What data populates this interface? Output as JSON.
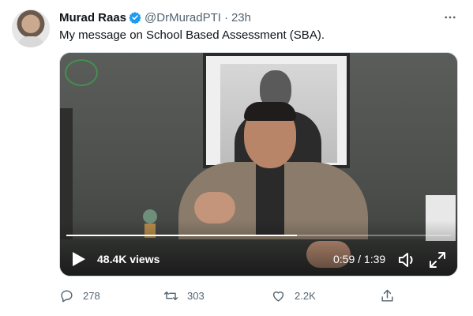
{
  "tweet": {
    "author_name": "Murad Raas",
    "handle": "@DrMuradPTI",
    "separator": "·",
    "time": "23h",
    "text": "My message on School Based Assessment (SBA).",
    "verified": true
  },
  "video": {
    "views_label": "48.4K views",
    "timecode": "0:59 / 1:39",
    "progress": 0.6
  },
  "actions": {
    "reply_count": "278",
    "retweet_count": "303",
    "like_count": "2.2K"
  },
  "colors": {
    "verified_blue": "#1d9bf0",
    "muted_gray": "#536471"
  },
  "icons": [
    "more-icon",
    "verified-badge-icon",
    "play-icon",
    "volume-icon",
    "fullscreen-icon",
    "reply-icon",
    "retweet-icon",
    "like-icon",
    "share-icon"
  ]
}
